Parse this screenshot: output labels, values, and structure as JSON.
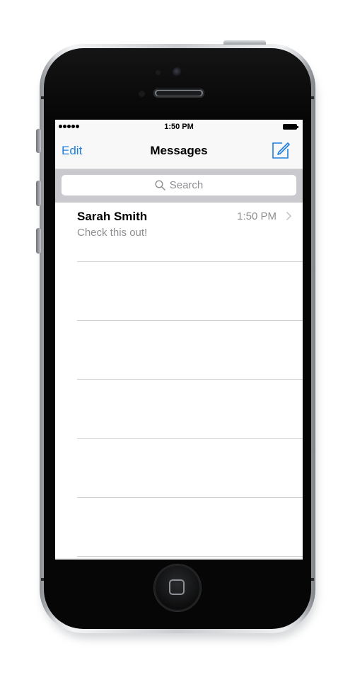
{
  "status_bar": {
    "signal_icon": "signal-dots-icon",
    "time": "1:50 PM",
    "battery_icon": "battery-full-icon"
  },
  "nav": {
    "left_label": "Edit",
    "title": "Messages",
    "compose_icon": "compose-icon"
  },
  "search": {
    "placeholder": "Search",
    "icon": "search-icon"
  },
  "conversations": [
    {
      "name": "Sarah Smith",
      "time": "1:50 PM",
      "preview": "Check this out!",
      "chevron_icon": "chevron-right-icon"
    }
  ],
  "empty_row_count_visible": 5,
  "colors": {
    "accent": "#1f7fe0",
    "secondary_text": "#8e8e93",
    "search_bar_bg": "#c9c9ce",
    "device_body": "#060606"
  }
}
